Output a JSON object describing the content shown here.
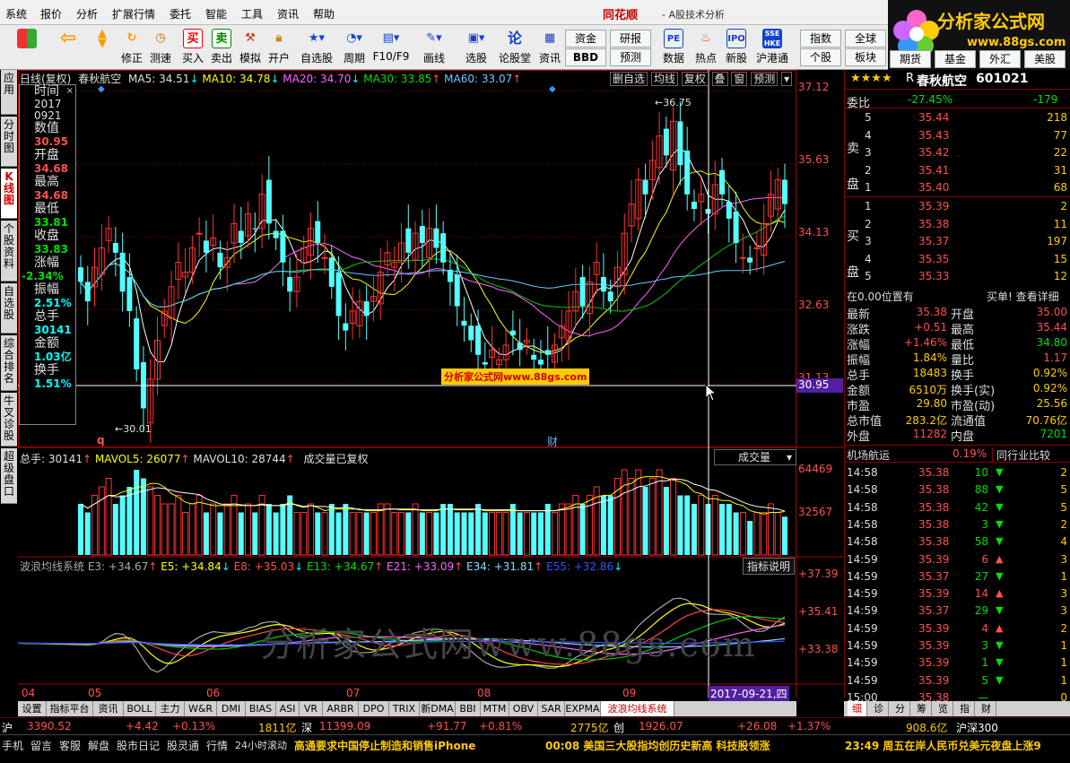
{
  "menu": {
    "items": [
      "系统",
      "报价",
      "分析",
      "扩展行情",
      "委托",
      "智能",
      "工具",
      "资讯",
      "帮助"
    ],
    "brand": "同花顺",
    "app_name": "- A股技术分析"
  },
  "logo": {
    "title": "分析家公式网",
    "url": "www.88gs.com"
  },
  "toolbar": {
    "buttons": [
      "修正",
      "测速",
      "买入",
      "卖出",
      "模拟",
      "开户",
      "自选股",
      "周期",
      "F10/F9",
      "画线",
      "选股",
      "论股堂",
      "资讯",
      "数据",
      "热点",
      "新股",
      "沪港通"
    ],
    "mini": [
      "资金",
      "研报",
      "BBD",
      "预测",
      "指数",
      "全球",
      "个股",
      "板块",
      "期货",
      "基金",
      "外汇",
      "美股"
    ]
  },
  "left_tabs": [
    "应用",
    "分时图",
    "K线图",
    "个股资料",
    "自选股",
    "综合排名",
    "牛叉诊股",
    "超级盘口"
  ],
  "kline_header": {
    "mode": "日线(复权)",
    "stock": "春秋航空",
    "ma5": "MA5: 34.51",
    "ma10": "MA10: 34.78",
    "ma20": "MA20: 34.70",
    "ma30": "MA30: 33.85",
    "ma60": "MA60: 33.07",
    "buttons": [
      "删自选",
      "均线",
      "复权",
      "叠",
      "窗",
      "预测"
    ]
  },
  "info_box": {
    "labels": [
      "时间",
      "数值",
      "开盘",
      "最高",
      "最低",
      "收盘",
      "涨幅",
      "振幅",
      "总手",
      "金额",
      "换手"
    ],
    "time": "2017\n0921",
    "values": [
      "30.95",
      "34.68",
      "34.68",
      "33.81",
      "33.83",
      "-2.34%",
      "2.51%",
      "30141",
      "1.03亿",
      "1.51%"
    ]
  },
  "price_axis": [
    "37.12",
    "35.63",
    "34.13",
    "32.63",
    "31.13"
  ],
  "crosshair_price": "30.95",
  "annotations": {
    "high": "36.75",
    "low": "30.01",
    "q": "q",
    "cai": "财"
  },
  "watermark_small": "分析家公式网www.88gs.com",
  "watermark_big": "分析家公式网www.88gs.com",
  "volume_header": {
    "total": "总手: 30141",
    "mavol5": "MAVOL5: 26077",
    "mavol10": "MAVOL10: 28744",
    "note": "成交量已复权",
    "select": "成交量"
  },
  "volume_axis": [
    "64469",
    "32567"
  ],
  "wave_header": {
    "name": "波浪均线系统",
    "e3": "E3: +34.67",
    "e5": "E5: +34.84",
    "e8": "E8: +35.03",
    "e13": "E13: +34.67",
    "e21": "E21: +33.09",
    "e34": "E34: +31.81",
    "e55": "E55: +32.86",
    "btn": "指标说明"
  },
  "wave_axis": [
    "+37.39",
    "+35.41",
    "+33.38"
  ],
  "date_axis": [
    "04",
    "05",
    "06",
    "07",
    "08",
    "09"
  ],
  "crosshair_date": "2017-09-21,四",
  "bottom_tabs": [
    "设置",
    "指标平台",
    "资讯",
    "BOLL",
    "主力",
    "W&R",
    "DMI",
    "BIAS",
    "ASI",
    "VR",
    "ARBR",
    "DPO",
    "TRIX",
    "新DMA",
    "BBI",
    "MTM",
    "OBV",
    "SAR",
    "EXPMA",
    "波浪均线系统"
  ],
  "right_tabs": [
    "细",
    "诊",
    "分",
    "筹",
    "览",
    "指",
    "财"
  ],
  "quote": {
    "stars": "★★★★",
    "flag": "R",
    "name": "春秋航空",
    "code": "601021",
    "weibi_label": "委比",
    "weibi": "-27.45%",
    "weicha": "-179",
    "sell_label": "卖盘",
    "buy_label": "买盘",
    "sells": [
      {
        "lv": "5",
        "price": "35.44",
        "vol": "218"
      },
      {
        "lv": "4",
        "price": "35.43",
        "vol": "77"
      },
      {
        "lv": "3",
        "price": "35.42",
        "vol": "22"
      },
      {
        "lv": "2",
        "price": "35.41",
        "vol": "31"
      },
      {
        "lv": "1",
        "price": "35.40",
        "vol": "68"
      }
    ],
    "buys": [
      {
        "lv": "1",
        "price": "35.39",
        "vol": "2"
      },
      {
        "lv": "2",
        "price": "35.38",
        "vol": "11"
      },
      {
        "lv": "3",
        "price": "35.37",
        "vol": "197"
      },
      {
        "lv": "4",
        "price": "35.35",
        "vol": "15"
      },
      {
        "lv": "5",
        "price": "35.33",
        "vol": "12"
      }
    ],
    "position_note": "在0.00位置有",
    "buy_note": "买单! 查看详细",
    "stats": [
      {
        "l1": "最新",
        "v1": "35.38",
        "l2": "开盘",
        "v2": "35.00"
      },
      {
        "l1": "涨跌",
        "v1": "+0.51",
        "l2": "最高",
        "v2": "35.44"
      },
      {
        "l1": "涨幅",
        "v1": "+1.46%",
        "l2": "最低",
        "v2": "34.80"
      },
      {
        "l1": "振幅",
        "v1": "1.84%",
        "l2": "量比",
        "v2": "1.17"
      },
      {
        "l1": "总手",
        "v1": "18483",
        "l2": "换手",
        "v2": "0.92%"
      },
      {
        "l1": "金额",
        "v1": "6510万",
        "l2": "换手(实)",
        "v2": "0.92%"
      },
      {
        "l1": "市盈",
        "v1": "29.80",
        "l2": "市盈(动)",
        "v2": "25.56"
      },
      {
        "l1": "总市值",
        "v1": "283.2亿",
        "l2": "流通值",
        "v2": "70.76亿"
      },
      {
        "l1": "外盘",
        "v1": "11282",
        "l2": "内盘",
        "v2": "7201"
      }
    ],
    "sector": "机场航运",
    "sector_pct": "0.19%",
    "compare": "同行业比较",
    "ticks": [
      {
        "t": "14:58",
        "p": "35.38",
        "v": "10",
        "d": "down",
        "n": "2"
      },
      {
        "t": "14:58",
        "p": "35.38",
        "v": "88",
        "d": "down",
        "n": "5"
      },
      {
        "t": "14:58",
        "p": "35.38",
        "v": "42",
        "d": "down",
        "n": "5"
      },
      {
        "t": "14:58",
        "p": "35.38",
        "v": "3",
        "d": "down",
        "n": "2"
      },
      {
        "t": "14:58",
        "p": "35.38",
        "v": "58",
        "d": "down",
        "n": "4"
      },
      {
        "t": "14:59",
        "p": "35.39",
        "v": "6",
        "d": "up",
        "n": "3"
      },
      {
        "t": "14:59",
        "p": "35.37",
        "v": "27",
        "d": "down",
        "n": "1"
      },
      {
        "t": "14:59",
        "p": "35.39",
        "v": "14",
        "d": "up",
        "n": "3"
      },
      {
        "t": "14:59",
        "p": "35.37",
        "v": "29",
        "d": "down",
        "n": "3"
      },
      {
        "t": "14:59",
        "p": "35.39",
        "v": "4",
        "d": "up",
        "n": "2"
      },
      {
        "t": "14:59",
        "p": "35.39",
        "v": "3",
        "d": "down",
        "n": "1"
      },
      {
        "t": "14:59",
        "p": "35.39",
        "v": "1",
        "d": "down",
        "n": "1"
      },
      {
        "t": "14:59",
        "p": "35.39",
        "v": "5",
        "d": "down",
        "n": "1"
      },
      {
        "t": "15:00",
        "p": "35.38",
        "v": "—",
        "d": "none",
        "n": "0"
      }
    ]
  },
  "index_bar": {
    "sh": "沪",
    "sh_val": "3390.52",
    "sh_chg": "+4.42",
    "sh_pct": "+0.13%",
    "sh_amt": "1811亿",
    "sz": "深",
    "sz_val": "11399.09",
    "sz_chg": "+91.77",
    "sz_pct": "+0.81%",
    "sz_amt": "2775亿",
    "cy": "创",
    "cy_val": "1926.07",
    "cy_chg": "+26.08",
    "cy_pct": "+1.37%",
    "hs_amt": "908.6亿",
    "hs": "沪深300"
  },
  "status_bar": {
    "items": [
      "手机",
      "留言",
      "客服",
      "解盘",
      "股市日记",
      "股灵通",
      "行情",
      "24小时滚动"
    ],
    "news1": "高通要求中国停止制造和销售iPhone",
    "news2": "00:08 美国三大股指均创历史新高 科技股领涨",
    "news3": "23:49 周五在岸人民币兑美元夜盘上涨9"
  },
  "chart_data": {
    "type": "candlestick",
    "period": "daily",
    "dates_range": [
      "2017-04",
      "2017-09-21"
    ],
    "ylim": [
      30.0,
      37.3
    ],
    "ohlc_close_series": [
      33.2,
      32.8,
      33.5,
      33.9,
      34.3,
      33.8,
      33.0,
      32.6,
      31.4,
      30.6,
      31.2,
      32.0,
      32.6,
      33.1,
      33.6,
      33.4,
      33.9,
      34.2,
      33.8,
      34.1,
      33.5,
      33.7,
      34.4,
      34.0,
      34.6,
      34.3,
      35.0,
      34.4,
      34.1,
      33.6,
      33.0,
      33.3,
      33.9,
      34.3,
      34.0,
      33.7,
      33.1,
      32.5,
      32.2,
      32.6,
      32.8,
      32.5,
      32.9,
      33.4,
      33.8,
      33.6,
      34.0,
      33.8,
      34.2,
      34.0,
      34.3,
      33.9,
      33.6,
      33.2,
      32.7,
      32.3,
      32.0,
      31.7,
      31.5,
      31.8,
      31.6,
      31.9,
      32.1,
      31.8,
      32.0,
      31.6,
      31.5,
      31.7,
      31.9,
      32.3,
      32.6,
      33.0,
      32.7,
      33.2,
      33.6,
      33.0,
      32.8,
      33.5,
      34.2,
      34.8,
      35.3,
      35.0,
      35.7,
      36.2,
      35.8,
      36.5,
      35.6,
      35.0,
      34.7,
      35.0,
      34.6,
      35.2,
      35.0,
      34.5,
      34.0,
      33.7,
      33.6,
      33.9,
      34.4,
      35.0,
      35.3,
      34.8
    ],
    "volume_relative": [
      0.6,
      0.5,
      0.7,
      0.8,
      0.9,
      0.6,
      0.7,
      0.8,
      1.0,
      0.9,
      0.8,
      0.7,
      0.6,
      0.6,
      0.7,
      0.5,
      0.6,
      0.7,
      0.5,
      0.6,
      0.5,
      0.6,
      0.7,
      0.5,
      0.6,
      0.5,
      0.7,
      0.6,
      0.5,
      0.6,
      0.7,
      0.5,
      0.5,
      0.6,
      0.5,
      0.5,
      0.6,
      0.5,
      0.6,
      0.5,
      0.5,
      0.5,
      0.5,
      0.6,
      0.6,
      0.5,
      0.5,
      0.5,
      0.6,
      0.5,
      0.5,
      0.5,
      0.6,
      0.6,
      0.5,
      0.5,
      0.5,
      0.6,
      0.5,
      0.5,
      0.5,
      0.5,
      0.6,
      0.5,
      0.5,
      0.5,
      0.5,
      0.6,
      0.5,
      0.6,
      0.6,
      0.7,
      0.6,
      0.7,
      0.8,
      0.7,
      0.7,
      0.9,
      1.0,
      0.9,
      1.0,
      0.8,
      0.9,
      1.0,
      0.8,
      0.9,
      0.7,
      0.7,
      0.6,
      0.7,
      0.6,
      0.7,
      0.6,
      0.6,
      0.5,
      0.5,
      0.4,
      0.5,
      0.5,
      0.6,
      0.5,
      0.45
    ]
  }
}
